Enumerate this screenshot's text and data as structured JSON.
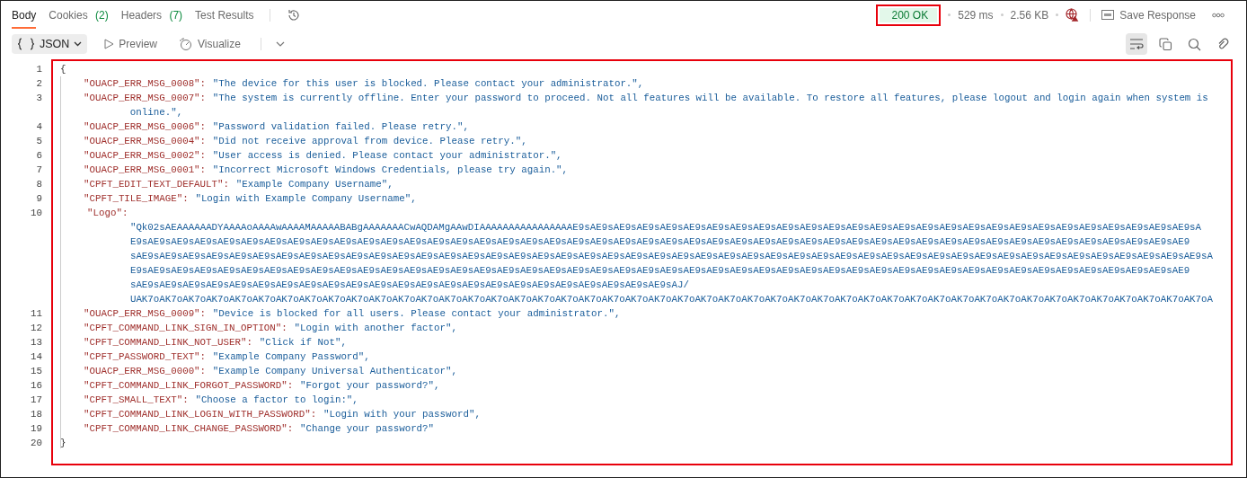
{
  "tabs": [
    {
      "label": "Body",
      "selected": true
    },
    {
      "label": "Cookies",
      "count": "(2)",
      "selected": false
    },
    {
      "label": "Headers",
      "count": "(7)",
      "selected": false
    },
    {
      "label": "Test Results",
      "selected": false
    }
  ],
  "status": {
    "code": "200 OK",
    "time": "529 ms",
    "size": "2.56 KB"
  },
  "save_button": "Save Response",
  "view_modes": [
    {
      "kind": "format",
      "label": "JSON",
      "selected": true
    },
    {
      "kind": "preview",
      "label": "Preview",
      "selected": false
    },
    {
      "kind": "visualize",
      "label": "Visualize",
      "selected": false
    }
  ],
  "tools": [
    {
      "kind": "wrap",
      "on": true
    },
    {
      "kind": "copy",
      "on": false
    },
    {
      "kind": "search",
      "on": false
    },
    {
      "kind": "link",
      "on": false
    }
  ],
  "code_lines": [
    {
      "number": "1",
      "kind": "brace",
      "text": "{"
    },
    {
      "number": "2",
      "kind": "pair",
      "key": "\"OUACP_ERR_MSG_0008\":",
      "value": "\"The device for this user is blocked. Please contact your administrator.\","
    },
    {
      "number": "3",
      "kind": "wrapped",
      "key": "\"OUACP_ERR_MSG_0007\":",
      "value_lines": [
        "\"The system is currently offline. Enter your password to proceed. Not all features will be available. To restore all features, please logout and login again when system is",
        "online.\","
      ]
    },
    {
      "number": "4",
      "kind": "pair",
      "key": "\"OUACP_ERR_MSG_0006\":",
      "value": "\"Password validation failed. Please retry.\","
    },
    {
      "number": "5",
      "kind": "pair",
      "key": "\"OUACP_ERR_MSG_0004\":",
      "value": "\"Did not receive approval from device. Please retry.\","
    },
    {
      "number": "6",
      "kind": "pair",
      "key": "\"OUACP_ERR_MSG_0002\":",
      "value": "\"User access is denied. Please contact your administrator.\","
    },
    {
      "number": "7",
      "kind": "pair",
      "key": "\"OUACP_ERR_MSG_0001\":",
      "value": "\"Incorrect Microsoft Windows Credentials, please try again.\","
    },
    {
      "number": "8",
      "kind": "pair",
      "key": "\"CPFT_EDIT_TEXT_DEFAULT\":",
      "value": "\"Example Company Username\","
    },
    {
      "number": "9",
      "kind": "pair",
      "key": "\"CPFT_TILE_IMAGE\":",
      "value": "\"Login with Example Company Username\","
    },
    {
      "number": "10",
      "kind": "block",
      "key": "\"Logo\":",
      "value_lines": [
        "\"Qk02sAEAAAAAADYAAAAoAAAAwAAAAMAAAAABABgAAAAAAACwAQDAMgAAwDIAAAAAAAAAAAAAAAAE9sAE9sAE9sAE9sAE9sAE9sAE9sAE9sAE9sAE9sAE9sAE9sAE9sAE9sAE9sAE9sAE9sAE9sAE9sAE9sAE9sAE9sAE9sAE9sAE9sAE9sAE9sA",
        "E9sAE9sAE9sAE9sAE9sAE9sAE9sAE9sAE9sAE9sAE9sAE9sAE9sAE9sAE9sAE9sAE9sAE9sAE9sAE9sAE9sAE9sAE9sAE9sAE9sAE9sAE9sAE9sAE9sAE9sAE9sAE9sAE9sAE9sAE9sAE9sAE9sAE9sAE9sAE9sAE9sAE9sAE9sAE9sAE9sAE9",
        "sAE9sAE9sAE9sAE9sAE9sAE9sAE9sAE9sAE9sAE9sAE9sAE9sAE9sAE9sAE9sAE9sAE9sAE9sAE9sAE9sAE9sAE9sAE9sAE9sAE9sAE9sAE9sAE9sAE9sAE9sAE9sAE9sAE9sAE9sAE9sAE9sAE9sAE9sAE9sAE9sAE9sAE9sAE9sAE9sAE9sAE9sA",
        "E9sAE9sAE9sAE9sAE9sAE9sAE9sAE9sAE9sAE9sAE9sAE9sAE9sAE9sAE9sAE9sAE9sAE9sAE9sAE9sAE9sAE9sAE9sAE9sAE9sAE9sAE9sAE9sAE9sAE9sAE9sAE9sAE9sAE9sAE9sAE9sAE9sAE9sAE9sAE9sAE9sAE9sAE9sAE9sAE9sAE9",
        "sAE9sAE9sAE9sAE9sAE9sAE9sAE9sAE9sAE9sAE9sAE9sAE9sAE9sAE9sAE9sAE9sAE9sAE9sAE9sAE9sAE9sAE9sAE9sAJ/",
        "UAK7oAK7oAK7oAK7oAK7oAK7oAK7oAK7oAK7oAK7oAK7oAK7oAK7oAK7oAK7oAK7oAK7oAK7oAK7oAK7oAK7oAK7oAK7oAK7oAK7oAK7oAK7oAK7oAK7oAK7oAK7oAK7oAK7oAK7oAK7oAK7oAK7oAK7oAK7oAK7oAK7oAK7oAK7oAK7oAK7oAK7oA"
      ]
    },
    {
      "number": "11",
      "kind": "pair",
      "key": "\"OUACP_ERR_MSG_0009\":",
      "value": "\"Device is blocked for all users. Please contact your administrator.\","
    },
    {
      "number": "12",
      "kind": "pair",
      "key": "\"CPFT_COMMAND_LINK_SIGN_IN_OPTION\":",
      "value": "\"Login with another factor\","
    },
    {
      "number": "13",
      "kind": "pair",
      "key": "\"CPFT_COMMAND_LINK_NOT_USER\":",
      "value": "\"Click if Not\","
    },
    {
      "number": "14",
      "kind": "pair",
      "key": "\"CPFT_PASSWORD_TEXT\":",
      "value": "\"Example Company Password\","
    },
    {
      "number": "15",
      "kind": "pair",
      "key": "\"OUACP_ERR_MSG_0000\":",
      "value": "\"Example Company Universal Authenticator\","
    },
    {
      "number": "16",
      "kind": "pair",
      "key": "\"CPFT_COMMAND_LINK_FORGOT_PASSWORD\":",
      "value": "\"Forgot your password?\","
    },
    {
      "number": "17",
      "kind": "pair",
      "key": "\"CPFT_SMALL_TEXT\":",
      "value": "\"Choose a factor to login:\","
    },
    {
      "number": "18",
      "kind": "pair",
      "key": "\"CPFT_COMMAND_LINK_LOGIN_WITH_PASSWORD\":",
      "value": "\"Login with your password\","
    },
    {
      "number": "19",
      "kind": "pair",
      "key": "\"CPFT_COMMAND_LINK_CHANGE_PASSWORD\":",
      "value": "\"Change your password?\""
    },
    {
      "number": "20",
      "kind": "brace",
      "text": "}"
    }
  ]
}
